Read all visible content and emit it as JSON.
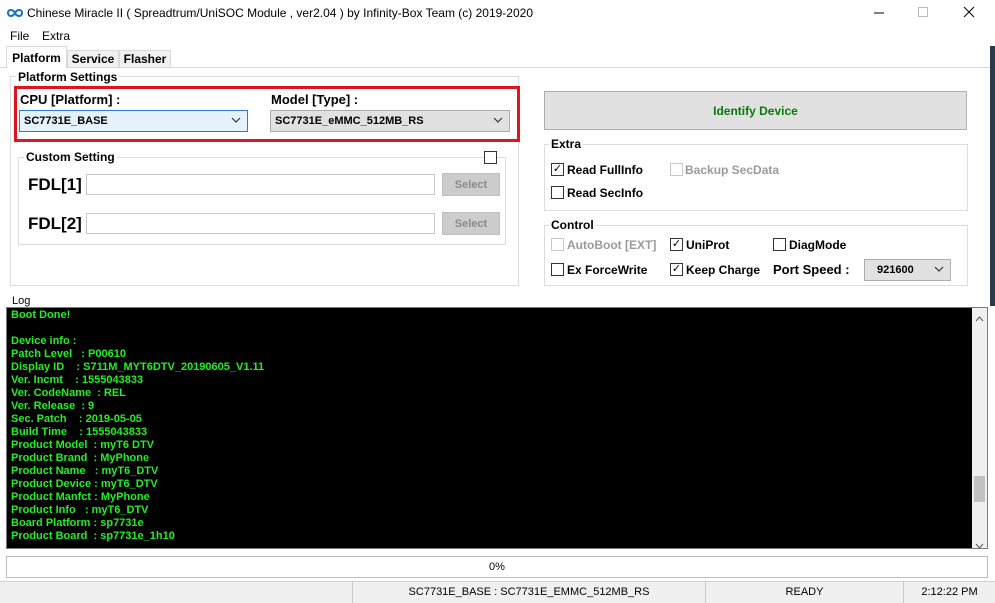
{
  "window": {
    "title": "Chinese Miracle II ( Spreadtrum/UniSOC Module , ver2.04 ) by Infinity-Box Team (c) 2019-2020",
    "app_icon": "infinity-icon",
    "controls": [
      "minimize-icon",
      "maximize-icon",
      "close-icon"
    ]
  },
  "menu": {
    "file": "File",
    "extra": "Extra"
  },
  "tabs": [
    {
      "label": "Platform",
      "active": true
    },
    {
      "label": "Service",
      "active": false
    },
    {
      "label": "Flasher",
      "active": false
    }
  ],
  "platform_settings": {
    "title": "Platform Settings",
    "cpu_label": "CPU [Platform] :",
    "cpu_value": "SC7731E_BASE",
    "model_label": "Model [Type] :",
    "model_value": "SC7731E_eMMC_512MB_RS",
    "highlight_color": "#e0141e"
  },
  "custom_setting": {
    "title": "Custom Setting",
    "checked": false,
    "fdl1_label": "FDL[1]",
    "fdl1_value": "",
    "fdl2_label": "FDL[2]",
    "fdl2_value": "",
    "select_label": "Select"
  },
  "identify": {
    "label": "Identify Device",
    "color": "#0a7a0a"
  },
  "extra": {
    "title": "Extra",
    "read_fullinfo": {
      "label": "Read FullInfo",
      "checked": true,
      "enabled": true
    },
    "backup_secdata": {
      "label": "Backup SecData",
      "checked": false,
      "enabled": false
    },
    "read_secinfo": {
      "label": "Read SecInfo",
      "checked": false,
      "enabled": true
    }
  },
  "control": {
    "title": "Control",
    "autoboot": {
      "label": "AutoBoot [EXT]",
      "checked": false,
      "enabled": false
    },
    "uniprot": {
      "label": "UniProt",
      "checked": true,
      "enabled": true
    },
    "diagmode": {
      "label": "DiagMode",
      "checked": false,
      "enabled": true
    },
    "ex_forcewrite": {
      "label": "Ex ForceWrite",
      "checked": false,
      "enabled": true
    },
    "keep_charge": {
      "label": "Keep Charge",
      "checked": true,
      "enabled": true
    },
    "port_speed_label": "Port Speed :",
    "port_speed_value": "921600"
  },
  "log": {
    "label": "Log",
    "text_color": "#22ee22",
    "lines": [
      "Boot Done!",
      "",
      "Device info :",
      "Patch Level   : P00610",
      "Display ID    : S711M_MYT6DTV_20190605_V1.11",
      "Ver. Incmt    : 1555043833",
      "Ver. CodeName  : REL",
      "Ver. Release  : 9",
      "Sec. Patch    : 2019-05-05",
      "Build Time    : 1555043833",
      "Product Model  : myT6 DTV",
      "Product Brand  : MyPhone",
      "Product Name   : myT6_DTV",
      "Product Device : myT6_DTV",
      "Product Manfct : MyPhone",
      "Product Info   : myT6_DTV",
      "Board Platform : sp7731e",
      "Product Board  : sp7731e_1h10"
    ]
  },
  "progress": {
    "text": "0%",
    "value": 0
  },
  "status": {
    "platform": "SC7731E_BASE : SC7731E_EMMC_512MB_RS",
    "state": "READY",
    "time": "2:12:22 PM"
  }
}
